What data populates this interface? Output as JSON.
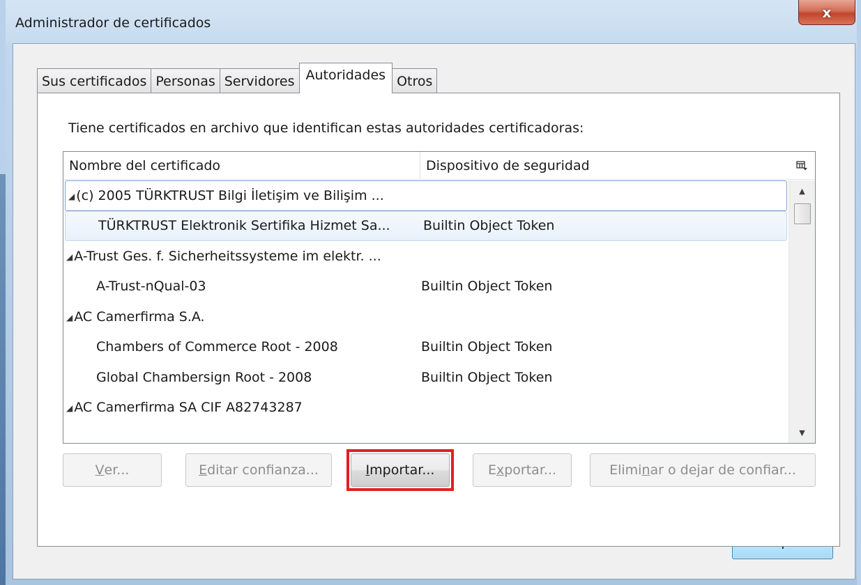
{
  "window": {
    "title": "Administrador de certificados",
    "close_glyph": "x"
  },
  "tabs": [
    {
      "label": "Sus certificados",
      "active": false
    },
    {
      "label": "Personas",
      "active": false
    },
    {
      "label": "Servidores",
      "active": false
    },
    {
      "label": "Autoridades",
      "active": true
    },
    {
      "label": "Otros",
      "active": false
    }
  ],
  "panel": {
    "intro": "Tiene certificados en archivo que identifican estas autoridades certificadoras:"
  },
  "tree": {
    "columns": {
      "name": "Nombre del certificado",
      "device": "Dispositivo de seguridad",
      "picker_icon": "column-picker-icon"
    },
    "rows": [
      {
        "type": "parent",
        "name": "(c) 2005 TÜRKTRUST Bilgi İletişim ve Bilişim ...",
        "device": ""
      },
      {
        "type": "child",
        "name": "TÜRKTRUST Elektronik Sertifika Hizmet Sa...",
        "device": "Builtin Object Token"
      },
      {
        "type": "parent",
        "name": "A-Trust Ges. f. Sicherheitssysteme im elektr. ...",
        "device": ""
      },
      {
        "type": "child",
        "name": "A-Trust-nQual-03",
        "device": "Builtin Object Token"
      },
      {
        "type": "parent",
        "name": "AC Camerfirma S.A.",
        "device": ""
      },
      {
        "type": "child",
        "name": "Chambers of Commerce Root - 2008",
        "device": "Builtin Object Token"
      },
      {
        "type": "child",
        "name": "Global Chambersign Root - 2008",
        "device": "Builtin Object Token"
      },
      {
        "type": "parent",
        "name": "AC Camerfirma SA CIF A82743287",
        "device": ""
      }
    ],
    "twisty_glyph": "◢"
  },
  "buttons": {
    "view": {
      "pre": "",
      "mnemonic": "V",
      "post": "er..."
    },
    "edit_trust": {
      "pre": "",
      "mnemonic": "E",
      "post": "ditar confianza..."
    },
    "import": {
      "pre": "",
      "mnemonic": "I",
      "post": "mportar..."
    },
    "export": {
      "pre": "E",
      "mnemonic": "x",
      "post": "portar..."
    },
    "delete": {
      "pre": "Elimi",
      "mnemonic": "n",
      "post": "ar o dejar de confiar..."
    },
    "ok": "Aceptar"
  },
  "colors": {
    "highlight": "#e02020",
    "title_bar": "#c6dbef",
    "close_button": "#c0452c"
  }
}
